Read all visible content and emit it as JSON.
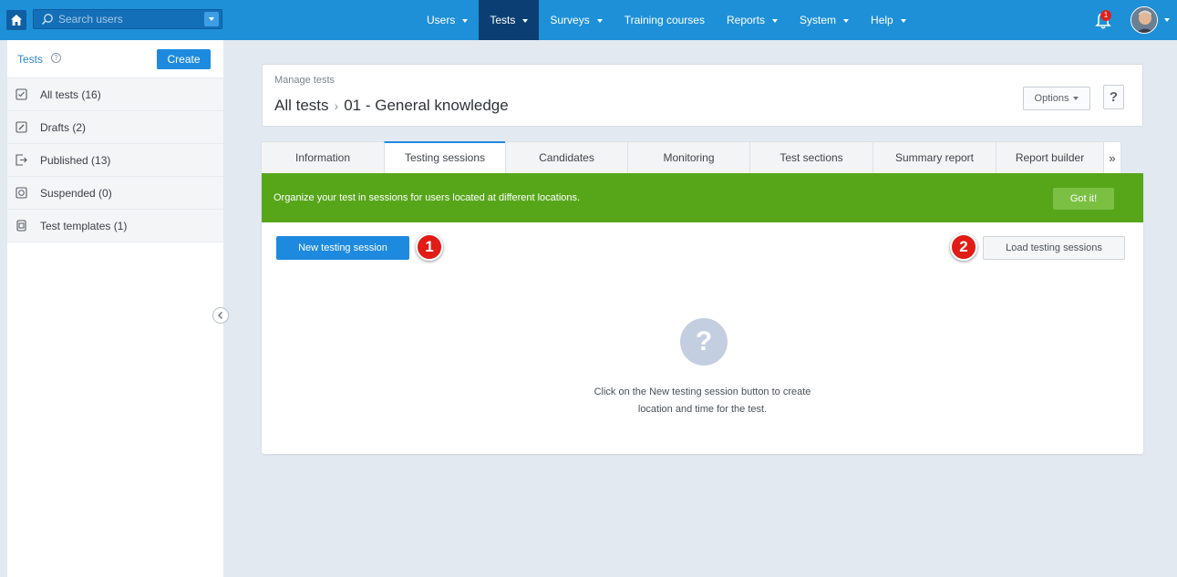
{
  "topbar": {
    "search_placeholder": "Search users",
    "nav": [
      {
        "label": "Users",
        "has_caret": true,
        "active": false
      },
      {
        "label": "Tests",
        "has_caret": true,
        "active": true
      },
      {
        "label": "Surveys",
        "has_caret": true,
        "active": false
      },
      {
        "label": "Training courses",
        "has_caret": false,
        "active": false
      },
      {
        "label": "Reports",
        "has_caret": true,
        "active": false
      },
      {
        "label": "System",
        "has_caret": true,
        "active": false
      },
      {
        "label": "Help",
        "has_caret": true,
        "active": false
      }
    ],
    "notification_count": "1"
  },
  "sidebar": {
    "title": "Tests",
    "create_label": "Create",
    "items": [
      {
        "label": "All tests (16)",
        "icon": "checkbox-icon"
      },
      {
        "label": "Drafts (2)",
        "icon": "edit-icon"
      },
      {
        "label": "Published (13)",
        "icon": "export-icon"
      },
      {
        "label": "Suspended (0)",
        "icon": "pause-icon"
      },
      {
        "label": "Test templates (1)",
        "icon": "template-icon"
      }
    ]
  },
  "header": {
    "section": "Manage tests",
    "title_root": "All tests",
    "title_sep": "›",
    "title_current": "01 - General knowledge",
    "options_label": "Options",
    "help_label": "?"
  },
  "tabs": [
    {
      "label": "Information",
      "active": false
    },
    {
      "label": "Testing sessions",
      "active": true
    },
    {
      "label": "Candidates",
      "active": false
    },
    {
      "label": "Monitoring",
      "active": false
    },
    {
      "label": "Test sections",
      "active": false
    },
    {
      "label": "Summary report",
      "active": false
    },
    {
      "label": "Report builder",
      "active": false
    }
  ],
  "tab_more": "»",
  "content": {
    "banner_text": "Organize your test in sessions for users located at different locations.",
    "got_it_label": "Got it!",
    "new_session_label": "New testing session",
    "load_sessions_label": "Load testing sessions",
    "marker_1": "1",
    "marker_2": "2",
    "empty_icon": "?",
    "empty_line1": "Click on the New testing session button to create",
    "empty_line2": "location and time for the test."
  },
  "colors": {
    "topbar": "#1e90d8",
    "nav_active": "#0b3f73",
    "banner": "#57a61a",
    "primary_button": "#1d8ae0",
    "marker": "#e11b15"
  }
}
